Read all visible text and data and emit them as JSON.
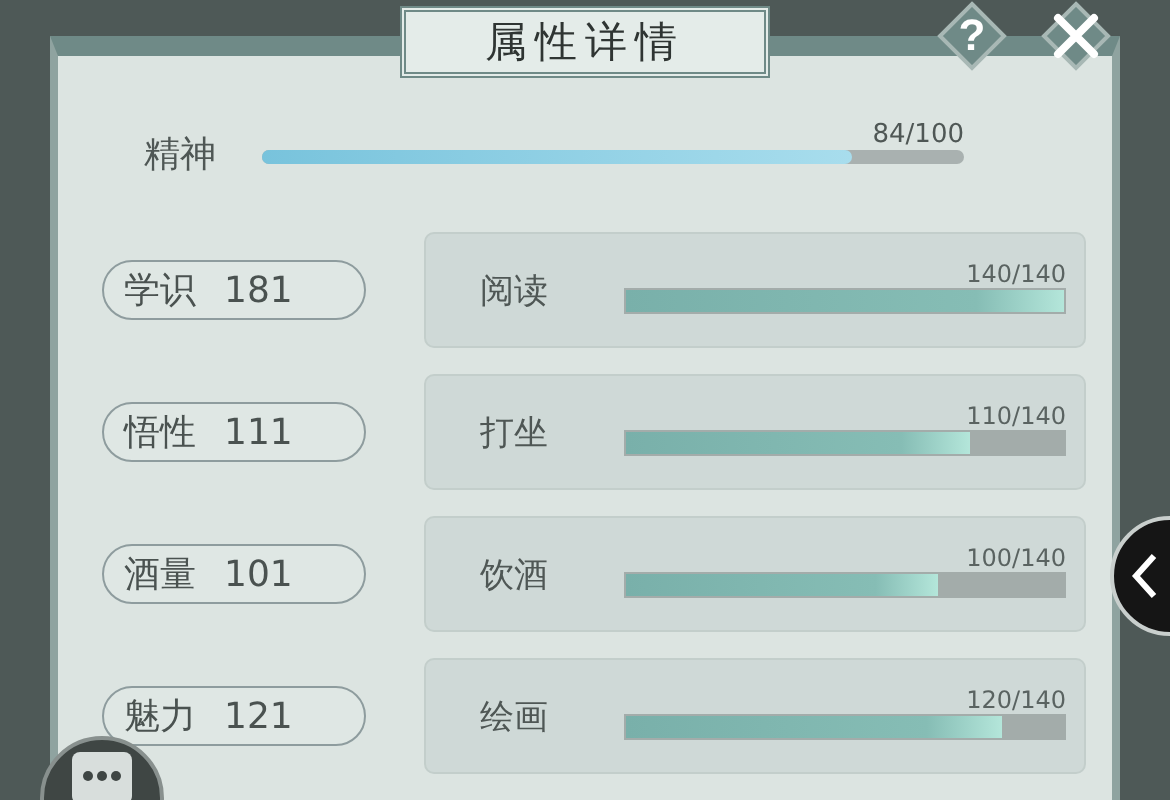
{
  "title": "属性详情",
  "help_button": {
    "label": "?"
  },
  "spirit": {
    "label": "精神",
    "value": "84/100",
    "level": 0.84
  },
  "attributes": [
    {
      "name": "学识",
      "value": "181",
      "activity": {
        "label": "阅读",
        "value": "140/140",
        "level": 1
      }
    },
    {
      "name": "悟性",
      "value": "111",
      "activity": {
        "label": "打坐",
        "value": "110/140",
        "level": 0.786
      }
    },
    {
      "name": "酒量",
      "value": "101",
      "activity": {
        "label": "饮酒",
        "value": "100/140",
        "level": 0.714
      }
    },
    {
      "name": "魅力",
      "value": "121",
      "activity": {
        "label": "绘画",
        "value": "120/140",
        "level": 0.857
      }
    }
  ]
}
